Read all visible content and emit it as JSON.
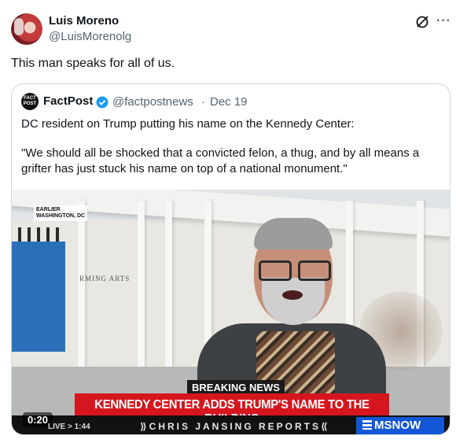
{
  "author": {
    "name": "Luis Moreno",
    "handle": "@LuisMorenolg"
  },
  "header_icons": {
    "grok": "grok-icon",
    "more": "···"
  },
  "tweet": {
    "text": "This man speaks for all of us."
  },
  "quoted": {
    "avatar_text": "FACT POST",
    "name": "FactPost",
    "verified_color": "#1d9bf0",
    "handle": "@factpostnews",
    "separator": "·",
    "date": "Dec 19",
    "text_line1": "DC resident on Trump putting his name on the Kennedy Center:",
    "text_line2": "\"We should all be shocked that a convicted felon, a thug, and by all means a grifter has just stuck his name on top of a national monument.\""
  },
  "video": {
    "location_tag_line1": "EARLIER",
    "location_tag_line2": "WASHINGTON, DC",
    "building_sign": "RMING ARTS",
    "breaking_label": "BREAKING NEWS",
    "headline": "KENNEDY CENTER ADDS TRUMP'S NAME TO THE BUILDING",
    "ticker": "⟫CHRIS JANSING REPORTS⟪",
    "network_logo": "MSNOW",
    "network_color": "#1457d6",
    "headline_color": "#d6161f",
    "timestamp": "0:20",
    "live_text": "LIVE > 1:44"
  }
}
